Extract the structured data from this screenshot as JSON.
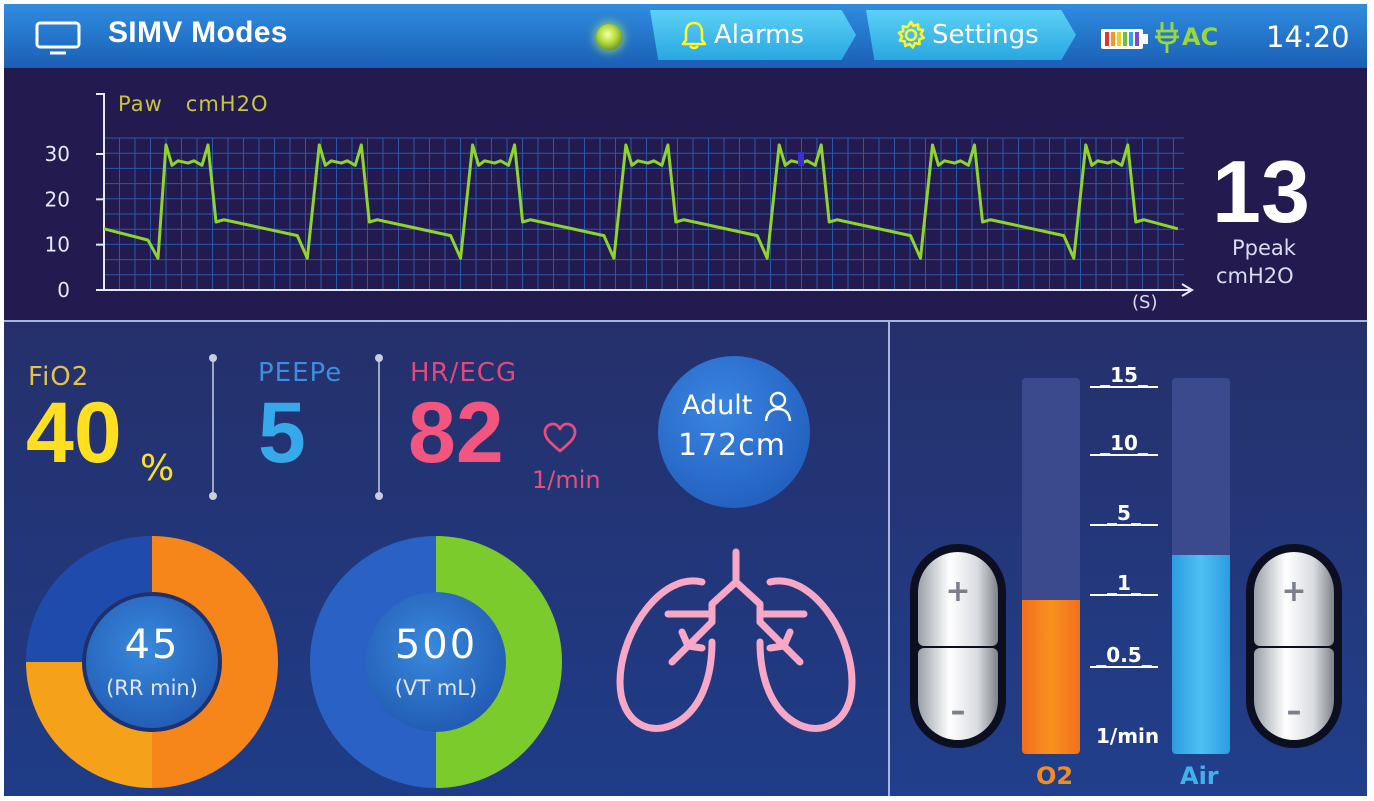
{
  "header": {
    "title": "SIMV Modes",
    "alarms_label": "Alarms",
    "settings_label": "Settings",
    "power_source": "AC",
    "time": "14:20"
  },
  "waveform": {
    "channel_label": "Paw",
    "unit": "cmH2O",
    "x_unit": "(S)",
    "y_ticks": [
      "30",
      "20",
      "10",
      "0"
    ],
    "y_range": [
      0,
      30
    ],
    "trace_color": "#8fd42d"
  },
  "ppeak": {
    "value": "13",
    "label": "Ppeak",
    "unit": "cmH2O"
  },
  "params": {
    "fio2": {
      "label": "FiO2",
      "value": "40",
      "unit": "%"
    },
    "peep": {
      "label": "PEEPe",
      "value": "5"
    },
    "hr": {
      "label": "HR/ECG",
      "value": "82",
      "unit": "1/min"
    }
  },
  "patient": {
    "type": "Adult",
    "height": "172cm"
  },
  "rr": {
    "value": "45",
    "label": "(RR min)"
  },
  "vt": {
    "value": "500",
    "label": "(VT mL)"
  },
  "flow": {
    "scale": [
      "_15_",
      "_10_",
      "_5_",
      "_1_",
      "_0.5_"
    ],
    "unit": "1/min",
    "o2": {
      "name": "O2",
      "level": 0.41
    },
    "air": {
      "name": "Air",
      "level": 0.53
    },
    "increase_symbol": "+",
    "decrease_symbol": "–"
  },
  "colors": {
    "fio2": "#ffe021",
    "peep": "#35a9ea",
    "hr": "#f2557f",
    "o2": "#f58b1f",
    "air": "#3fb2ee"
  }
}
